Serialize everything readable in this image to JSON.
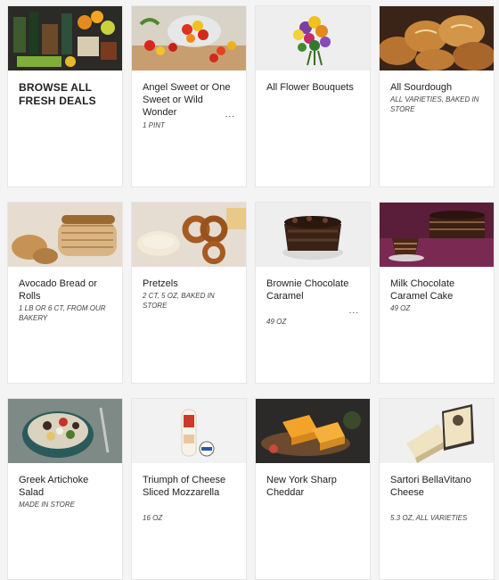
{
  "products": [
    {
      "title": "BROWSE ALL FRESH DEALS",
      "subtitle": "",
      "featured": true,
      "icon": "grocery-assortment-image"
    },
    {
      "title": "Angel Sweet or One Sweet or Wild Wonder",
      "subtitle": "1 PINT",
      "more": "...",
      "icon": "tomatoes-image"
    },
    {
      "title": "All Flower Bouquets",
      "subtitle": "",
      "icon": "flower-bouquet-image"
    },
    {
      "title": "All Sourdough",
      "subtitle": "ALL VARIETIES, BAKED IN STORE",
      "icon": "sourdough-bread-image"
    },
    {
      "title": "Avocado Bread or Rolls",
      "subtitle": "1 LB OR 6 CT, FROM OUR BAKERY",
      "icon": "avocado-bread-image"
    },
    {
      "title": "Pretzels",
      "subtitle": "2 CT, 5 OZ, BAKED IN STORE",
      "icon": "pretzels-image"
    },
    {
      "title": "Brownie Chocolate Caramel",
      "subtitle": "49 OZ",
      "more": "...",
      "icon": "brownie-cake-image"
    },
    {
      "title": "Milk Chocolate Caramel Cake",
      "subtitle": "49 OZ",
      "icon": "chocolate-cake-image"
    },
    {
      "title": "Greek Artichoke Salad",
      "subtitle": "MADE IN STORE",
      "icon": "salad-image"
    },
    {
      "title": "Triumph of Cheese Sliced Mozzarella",
      "subtitle": "16 OZ",
      "icon": "mozzarella-image"
    },
    {
      "title": "New York Sharp Cheddar",
      "subtitle": "",
      "icon": "cheddar-image"
    },
    {
      "title": "Sartori BellaVitano Cheese",
      "subtitle": "5.3 OZ, ALL VARIETIES",
      "icon": "bellavitano-image"
    }
  ]
}
